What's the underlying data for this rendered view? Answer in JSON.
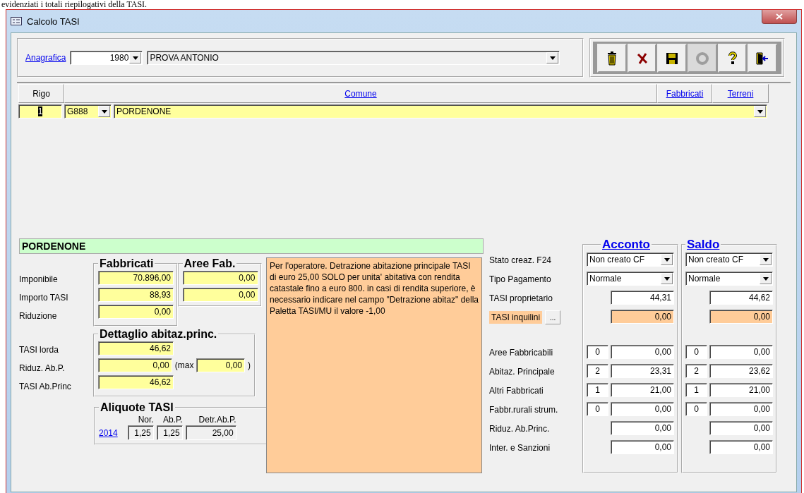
{
  "caption": "evidenziati i totali riepilogativi della TASI.",
  "window": {
    "title": "Calcolo TASI"
  },
  "header": {
    "link": "Anagrafica",
    "code": "1980",
    "name": "PROVA ANTONIO"
  },
  "toolbar": [
    {
      "kind": "trash",
      "disabled": false
    },
    {
      "kind": "cancel",
      "disabled": false
    },
    {
      "kind": "save",
      "disabled": false
    },
    {
      "kind": "refresh",
      "disabled": true
    },
    {
      "kind": "help",
      "disabled": false
    },
    {
      "kind": "exit",
      "disabled": false
    }
  ],
  "grid": {
    "columns": [
      "Rigo",
      "Comune",
      "Fabbricati",
      "Terreni"
    ],
    "rows": [
      {
        "rigo": "1",
        "code": "G888",
        "comune": "PORDENONE",
        "selected": true
      }
    ]
  },
  "detail": {
    "title": "PORDENONE",
    "fabbricati_heading": "Fabbricati",
    "aree_heading": "Aree Fab.",
    "rows": [
      {
        "label": "Imponibile",
        "fabbricati": "70.896,00",
        "aree": "0,00"
      },
      {
        "label": "Importo TASI",
        "fabbricati": "88,93",
        "aree": "0,00"
      },
      {
        "label": "Riduzione",
        "fabbricati": "0,00"
      }
    ],
    "abitaz_heading": "Dettaglio abitaz.princ.",
    "abitaz_rows": [
      {
        "label": "TASI lorda",
        "value": "46,62"
      },
      {
        "label": "Riduz. Ab.P.",
        "value": "0,00",
        "max_open": "(max",
        "max_value": "0,00",
        "max_close": ")"
      },
      {
        "label": "TASI Ab.Princ",
        "value": "46,62"
      }
    ],
    "aliquote": {
      "heading": "Aliquote TASI",
      "year": "2014",
      "columns": [
        "Nor.",
        "Ab.P.",
        "Detr.Ab.P."
      ],
      "values": [
        "1,25",
        "1,25",
        "25,00"
      ]
    }
  },
  "note": "Per l'operatore. Detrazione abitazione principale TASI di euro 25,00 SOLO per unita' abitativa con rendita catastale fino a euro 800. in casi di rendita superiore, è necessario indicare nel campo \"Detrazione abitaz\" della Paletta TASI/MU il valore -1,00",
  "payments": {
    "columns": [
      "Acconto",
      "Saldo"
    ],
    "top_rows": [
      {
        "kind": "select",
        "label": "Stato creaz. F24",
        "cells": [
          {
            "value": "Non creato CF"
          },
          {
            "value": "Non creato CF"
          }
        ]
      },
      {
        "kind": "select",
        "label": "Tipo Pagamento",
        "cells": [
          {
            "value": "Normale"
          },
          {
            "value": "Normale"
          }
        ]
      },
      {
        "kind": "amount",
        "label": "TASI proprietario",
        "cells": [
          {
            "value": "44,31"
          },
          {
            "value": "44,62"
          }
        ]
      },
      {
        "kind": "tenant",
        "label": "TASI inquilini",
        "button": "...",
        "cells": [
          {
            "value": "0,00"
          },
          {
            "value": "0,00"
          }
        ]
      }
    ],
    "bottom_rows": [
      {
        "kind": "count",
        "label": "Aree Fabbricabili",
        "cells": [
          {
            "count": "0",
            "value": "0,00"
          },
          {
            "count": "0",
            "value": "0,00"
          }
        ]
      },
      {
        "kind": "count",
        "label": "Abitaz. Principale",
        "cells": [
          {
            "count": "2",
            "value": "23,31"
          },
          {
            "count": "2",
            "value": "23,62"
          }
        ]
      },
      {
        "kind": "count",
        "label": "Altri Fabbricati",
        "cells": [
          {
            "count": "1",
            "value": "21,00"
          },
          {
            "count": "1",
            "value": "21,00"
          }
        ]
      },
      {
        "kind": "count",
        "label": "Fabbr.rurali strum.",
        "cells": [
          {
            "count": "0",
            "value": "0,00"
          },
          {
            "count": "0",
            "value": "0,00"
          }
        ]
      },
      {
        "kind": "amount",
        "label": "Riduz. Ab.Princ.",
        "cells": [
          {
            "value": "0,00"
          },
          {
            "value": "0,00"
          }
        ]
      },
      {
        "kind": "amount",
        "label": "Inter. e Sanzioni",
        "cells": [
          {
            "value": "0,00"
          },
          {
            "value": "0,00"
          }
        ]
      }
    ]
  }
}
